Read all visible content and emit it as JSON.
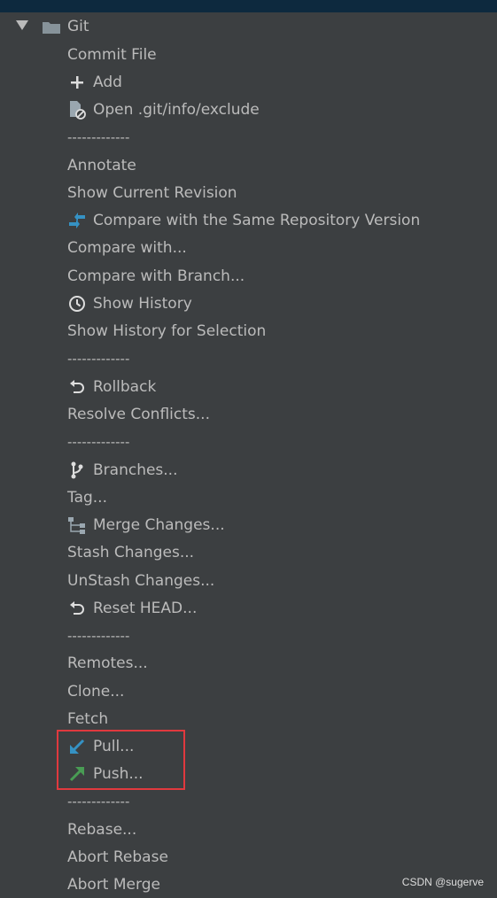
{
  "tree": {
    "root_label": "Git"
  },
  "menu": {
    "separator": "-------------",
    "items": [
      {
        "label": "Commit File",
        "icon": "none"
      },
      {
        "label": "Add",
        "icon": "plus-icon"
      },
      {
        "label": "Open .git/info/exclude",
        "icon": "ignore-file-icon"
      },
      {
        "label": "-------------",
        "icon": "separator"
      },
      {
        "label": "Annotate",
        "icon": "none"
      },
      {
        "label": "Show Current Revision",
        "icon": "none"
      },
      {
        "label": "Compare with the Same Repository Version",
        "icon": "diff-icon"
      },
      {
        "label": "Compare with...",
        "icon": "none"
      },
      {
        "label": "Compare with Branch...",
        "icon": "none"
      },
      {
        "label": "Show History",
        "icon": "history-clock-icon"
      },
      {
        "label": "Show History for Selection",
        "icon": "none"
      },
      {
        "label": "-------------",
        "icon": "separator"
      },
      {
        "label": "Rollback",
        "icon": "undo-icon"
      },
      {
        "label": "Resolve Conflicts...",
        "icon": "none"
      },
      {
        "label": "-------------",
        "icon": "separator"
      },
      {
        "label": "Branches...",
        "icon": "branch-icon"
      },
      {
        "label": "Tag...",
        "icon": "none"
      },
      {
        "label": "Merge Changes...",
        "icon": "merge-icon"
      },
      {
        "label": "Stash Changes...",
        "icon": "none"
      },
      {
        "label": "UnStash Changes...",
        "icon": "none"
      },
      {
        "label": "Reset HEAD...",
        "icon": "undo-icon"
      },
      {
        "label": "-------------",
        "icon": "separator"
      },
      {
        "label": "Remotes...",
        "icon": "none"
      },
      {
        "label": "Clone...",
        "icon": "none"
      },
      {
        "label": "Fetch",
        "icon": "none"
      },
      {
        "label": "Pull...",
        "icon": "pull-arrow-icon"
      },
      {
        "label": "Push...",
        "icon": "push-arrow-icon"
      },
      {
        "label": "-------------",
        "icon": "separator"
      },
      {
        "label": "Rebase...",
        "icon": "none"
      },
      {
        "label": "Abort Rebase",
        "icon": "none"
      },
      {
        "label": "Abort Merge",
        "icon": "none"
      }
    ]
  },
  "colors": {
    "background": "#3c3f41",
    "text": "#bbbbbb",
    "highlight_border": "#e0393e",
    "pull_icon": "#3592c4",
    "push_icon": "#499c54",
    "top_bar": "#0d293e"
  },
  "watermark": "CSDN @sugerve"
}
